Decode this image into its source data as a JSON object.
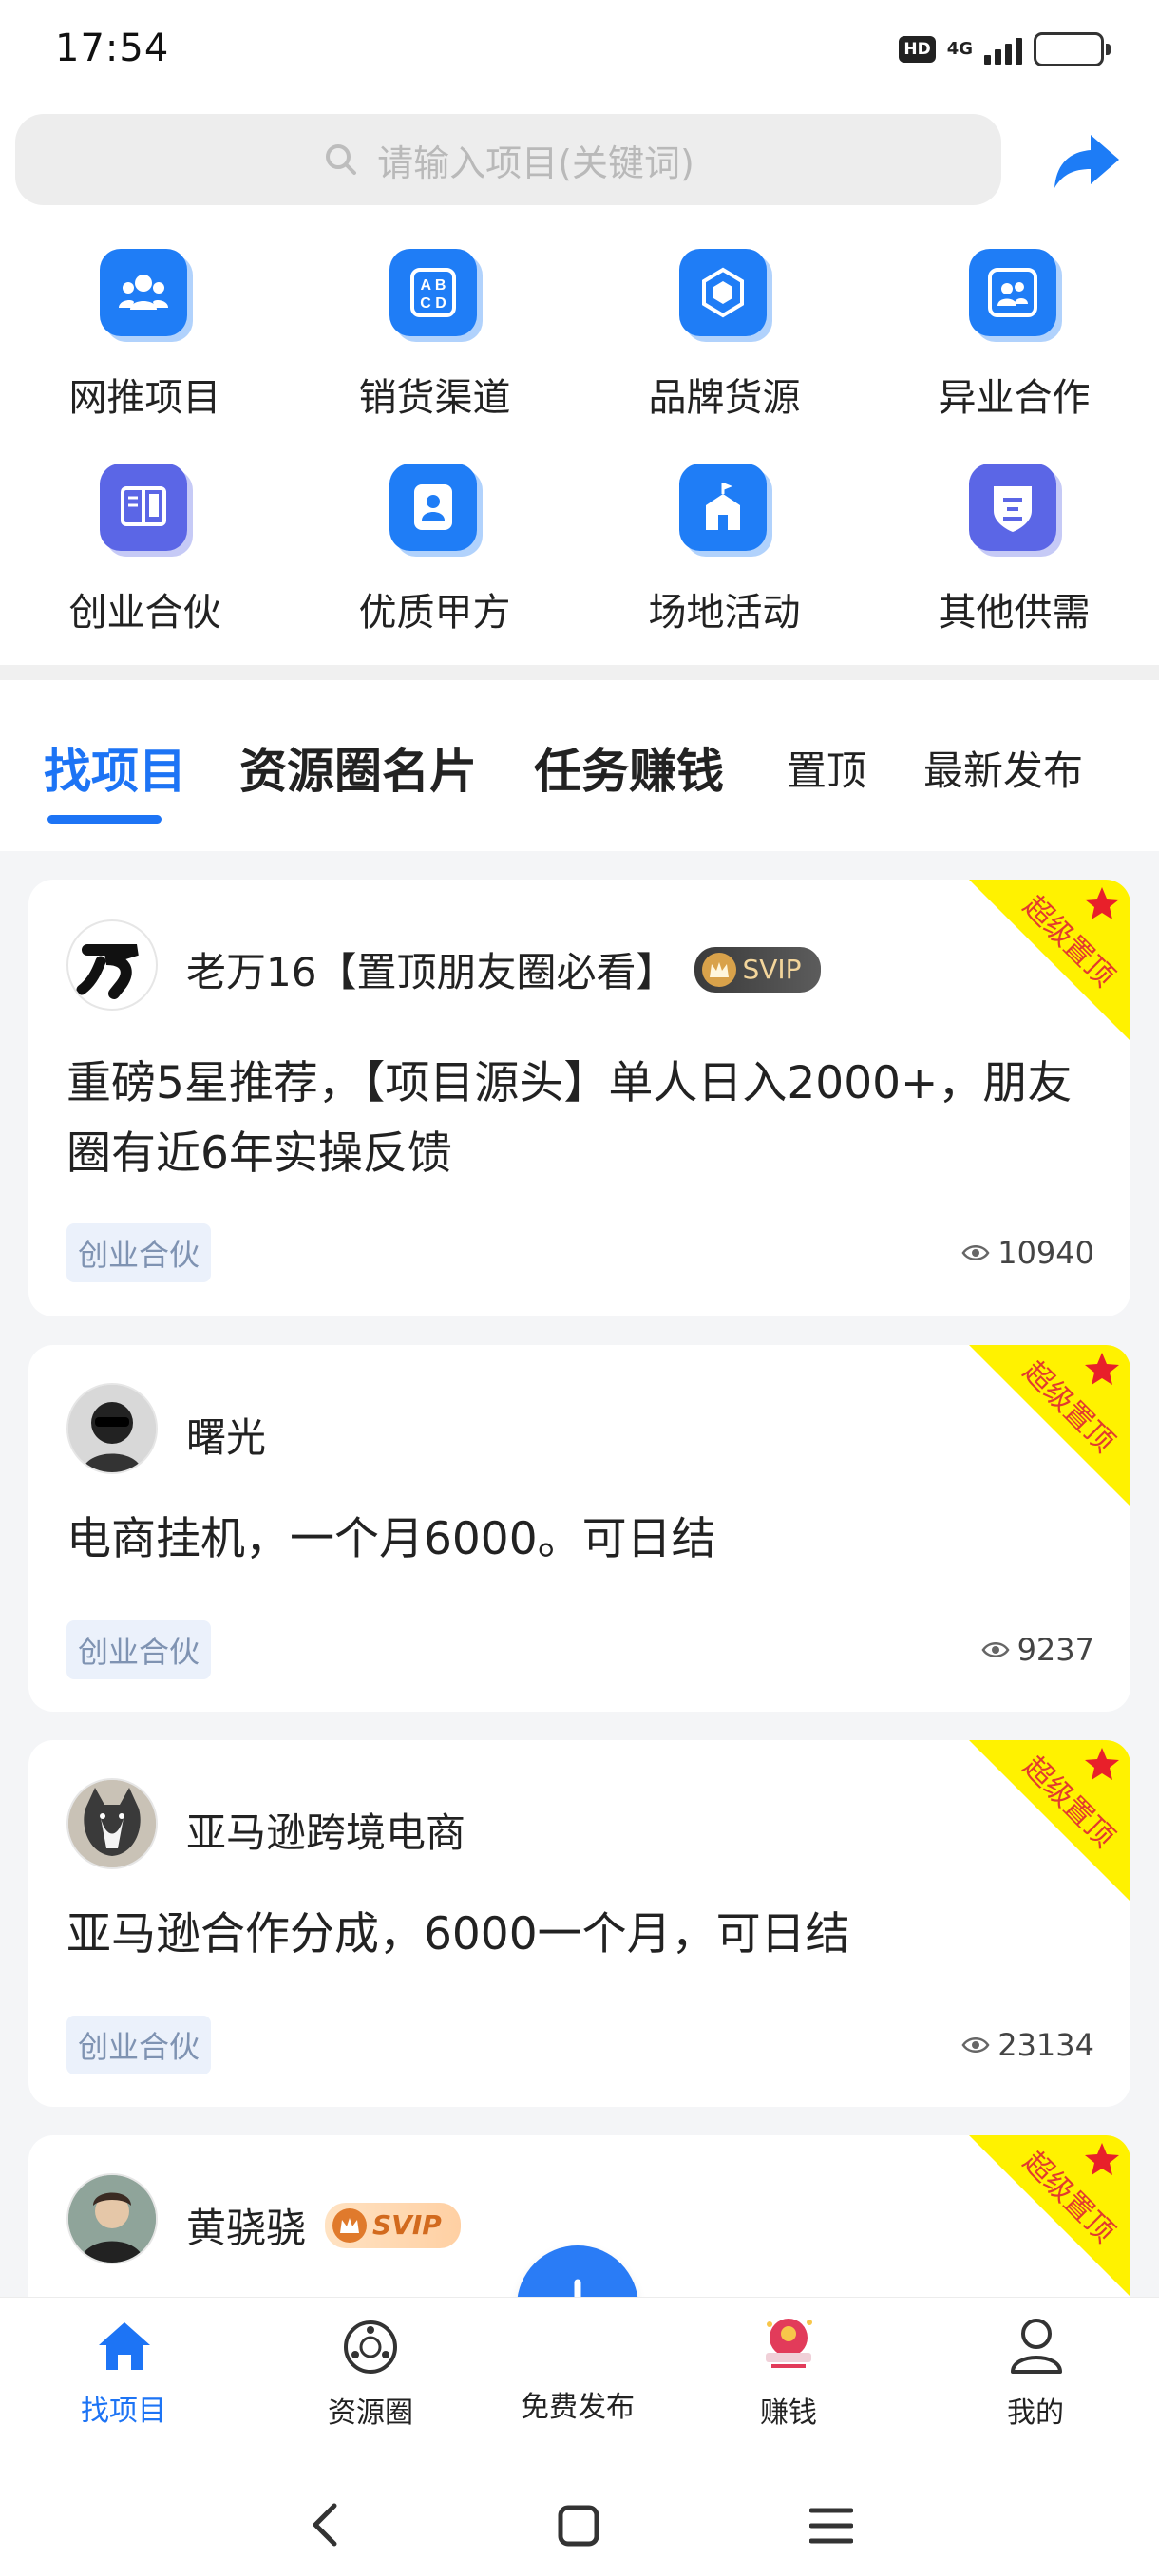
{
  "status_bar": {
    "time": "17:54",
    "hd": "HD",
    "network": "4G"
  },
  "search": {
    "placeholder": "请输入项目(关键词)"
  },
  "categories": [
    {
      "label": "网推项目",
      "icon": "people-icon",
      "color": "#1f7df6"
    },
    {
      "label": "销货渠道",
      "icon": "abcd-icon",
      "color": "#1f7df6"
    },
    {
      "label": "品牌货源",
      "icon": "cubes-icon",
      "color": "#1f7df6"
    },
    {
      "label": "异业合作",
      "icon": "group-card-icon",
      "color": "#1f7df6"
    },
    {
      "label": "创业合伙",
      "icon": "book-icon",
      "color": "#5b66e6"
    },
    {
      "label": "优质甲方",
      "icon": "contact-card-icon",
      "color": "#1f7df6"
    },
    {
      "label": "场地活动",
      "icon": "building-icon",
      "color": "#1f7df6"
    },
    {
      "label": "其他供需",
      "icon": "shield-icon",
      "color": "#5b66e6"
    }
  ],
  "tabs": [
    {
      "label": "找项目",
      "active": true
    },
    {
      "label": "资源圈名片"
    },
    {
      "label": "任务赚钱"
    },
    {
      "label": "置顶"
    },
    {
      "label": "最新发布"
    }
  ],
  "ribbon_label": "超级置顶",
  "posts": [
    {
      "user": "老万16【置顶朋友圈必看】",
      "badge": "SVIP",
      "title": "重磅5星推荐，【项目源头】单人日入2000+，朋友圈有近6年实操反馈",
      "tag": "创业合伙",
      "views": "10940"
    },
    {
      "user": "曙光",
      "title": "电商挂机，一个月6000。可日结",
      "tag": "创业合伙",
      "views": "9237"
    },
    {
      "user": "亚马逊跨境电商",
      "title": "亚马逊合作分成，6000一个月，可日结",
      "tag": "创业合伙",
      "views": "23134"
    },
    {
      "user": "黄骁骁",
      "badge": "SVIP"
    }
  ],
  "bottom_nav": [
    {
      "label": "找项目",
      "active": true
    },
    {
      "label": "资源圈"
    },
    {
      "label": "免费发布"
    },
    {
      "label": "赚钱"
    },
    {
      "label": "我的"
    }
  ]
}
